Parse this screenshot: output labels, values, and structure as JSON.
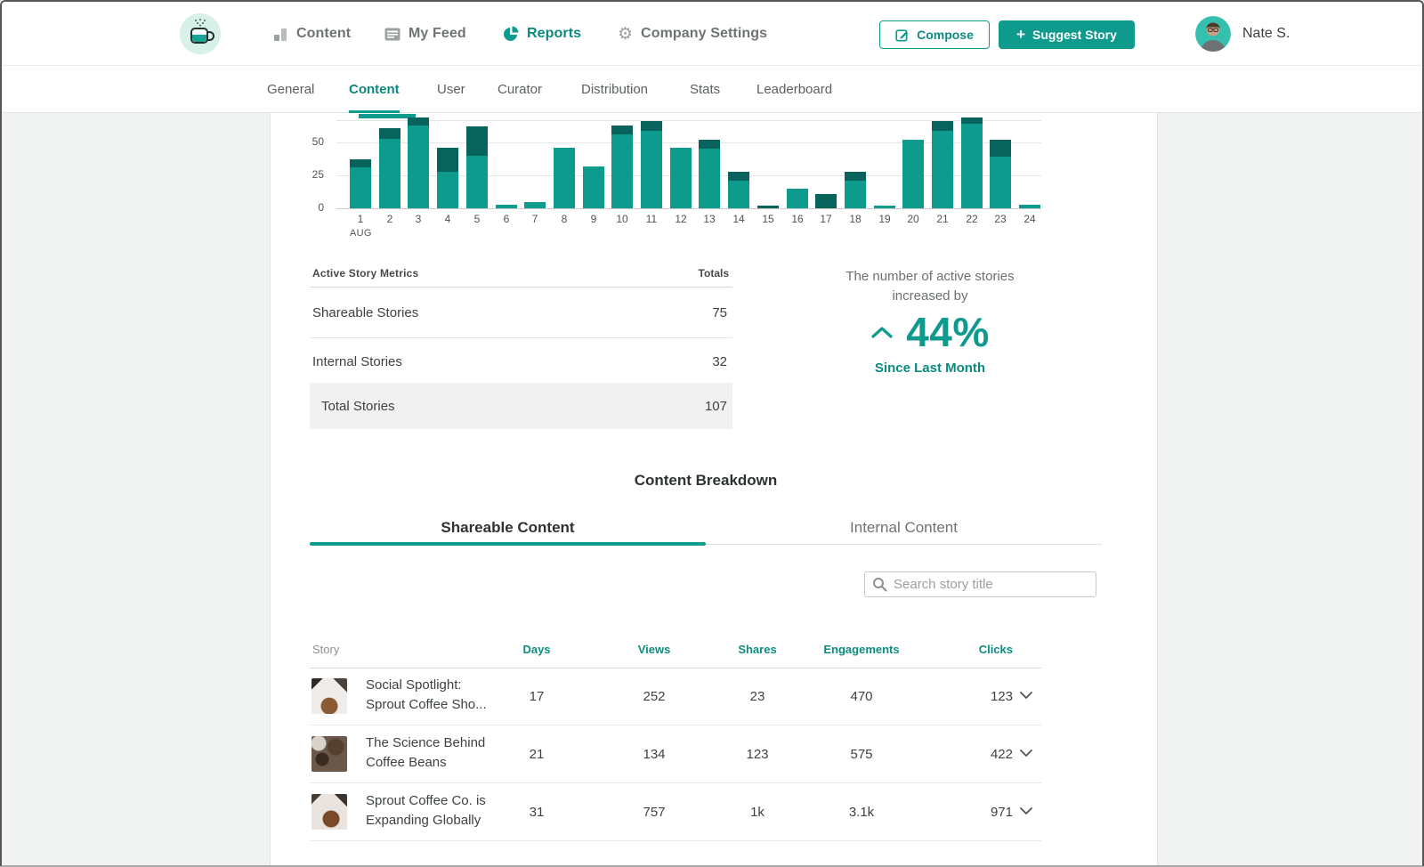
{
  "topnav": {
    "items": [
      {
        "label": "Content",
        "icon": "bar-chart-icon"
      },
      {
        "label": "My Feed",
        "icon": "feed-icon"
      },
      {
        "label": "Reports",
        "icon": "pie-chart-icon",
        "active": true
      },
      {
        "label": "Company Settings",
        "icon": "gear-icon"
      }
    ],
    "compose_label": "Compose",
    "suggest_label": "Suggest Story",
    "user_name": "Nate S."
  },
  "subnav": {
    "tabs": [
      {
        "label": "General"
      },
      {
        "label": "Content",
        "active": true
      },
      {
        "label": "User"
      },
      {
        "label": "Curator"
      },
      {
        "label": "Distribution"
      },
      {
        "label": "Stats"
      },
      {
        "label": "Leaderboard"
      }
    ]
  },
  "chart_data": {
    "type": "bar",
    "stacked": true,
    "x": [
      "1",
      "2",
      "3",
      "4",
      "5",
      "6",
      "7",
      "8",
      "9",
      "10",
      "11",
      "12",
      "13",
      "14",
      "15",
      "16",
      "17",
      "18",
      "19",
      "20",
      "21",
      "22",
      "23",
      "24"
    ],
    "month_label": "AUG",
    "y_ticks": [
      0,
      25,
      50
    ],
    "ylim": [
      0,
      68
    ],
    "grid": true,
    "series": [
      {
        "name": "primary",
        "color": "#0F9A8E",
        "values": [
          31,
          53,
          63,
          28,
          40,
          3,
          5,
          46,
          32,
          56,
          59,
          46,
          45,
          21,
          0,
          15,
          0,
          21,
          2,
          52,
          59,
          64,
          39,
          3
        ]
      },
      {
        "name": "secondary",
        "color": "#07635C",
        "values": [
          6,
          8,
          6,
          18,
          22,
          0,
          0,
          0,
          0,
          7,
          7,
          0,
          7,
          7,
          2,
          0,
          11,
          7,
          0,
          0,
          7,
          5,
          13,
          0
        ]
      }
    ]
  },
  "metrics": {
    "title": "Active Story Metrics",
    "totals_label": "Totals",
    "rows": [
      {
        "label": "Shareable Stories",
        "value": "75"
      },
      {
        "label": "Internal Stories",
        "value": "32"
      }
    ],
    "total_row": {
      "label": "Total Stories",
      "value": "107"
    }
  },
  "stat": {
    "line1": "The number of active stories",
    "line2": "increased by",
    "direction": "up",
    "value": "44%",
    "subtitle": "Since Last Month"
  },
  "breakdown": {
    "title": "Content Breakdown",
    "tabs": [
      {
        "label": "Shareable Content",
        "active": true
      },
      {
        "label": "Internal Content",
        "active": false
      }
    ],
    "search_placeholder": "Search story title"
  },
  "stories": {
    "header": {
      "story": "Story",
      "days": "Days",
      "views": "Views",
      "shares": "Shares",
      "engagements": "Engagements",
      "clicks": "Clicks"
    },
    "rows": [
      {
        "thumb": "coffee-cup-photo",
        "title_line1": "Social Spotlight:",
        "title_line2": "Sprout Coffee Sho...",
        "days": "17",
        "views": "252",
        "shares": "23",
        "engagements": "470",
        "clicks": "123"
      },
      {
        "thumb": "coffee-beans-photo",
        "title_line1": "The Science Behind",
        "title_line2": "Coffee Beans",
        "days": "21",
        "views": "134",
        "shares": "123",
        "engagements": "575",
        "clicks": "422"
      },
      {
        "thumb": "coffee-pour-photo",
        "title_line1": "Sprout Coffee Co. is",
        "title_line2": "Expanding Globally",
        "days": "31",
        "views": "757",
        "shares": "1k",
        "engagements": "3.1k",
        "clicks": "971"
      }
    ]
  },
  "colors": {
    "brand_teal": "#0F9A8E",
    "dark_teal": "#07635C",
    "teal_text": "#0A8A7F",
    "page_bg": "#F1F2F2"
  }
}
